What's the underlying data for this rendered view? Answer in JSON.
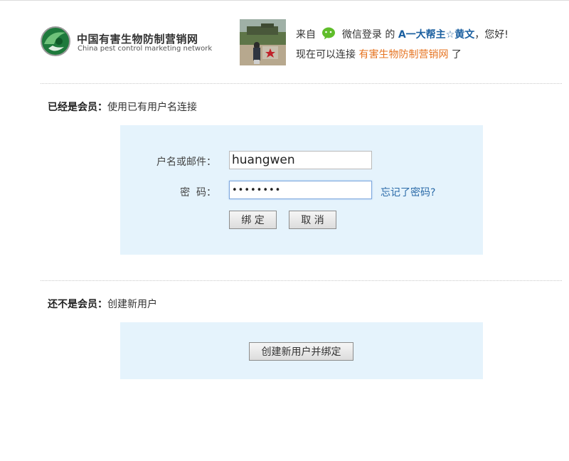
{
  "header": {
    "logo_cn": "中国有害生物防制营销网",
    "logo_en": "China pest control marketing network",
    "welcome_prefix": "来自",
    "welcome_source": "微信登录",
    "welcome_de": "的",
    "nickname": "A一大帮主☆黄文",
    "welcome_suffix": "，您好!",
    "connect_prefix": "现在可以连接",
    "site_name": "有害生物防制营销网",
    "connect_suffix": "了"
  },
  "member_section": {
    "title_bold": "已经是会员：",
    "title_rest": "使用已有用户名连接",
    "username_label": "户名或邮件：",
    "username_value": "huangwen",
    "password_label": "密  码：",
    "password_value": "••••••••",
    "forgot_link": "忘记了密码?",
    "bind_button": "绑 定",
    "cancel_button": "取 消"
  },
  "new_section": {
    "title_bold": "还不是会员：",
    "title_rest": "创建新用户",
    "create_button": "创建新用户并绑定"
  },
  "colors": {
    "panel_bg": "#e5f3fc",
    "site_link": "#e67422",
    "nickname": "#1a5fa0",
    "forgot_link": "#2a6aa8"
  }
}
